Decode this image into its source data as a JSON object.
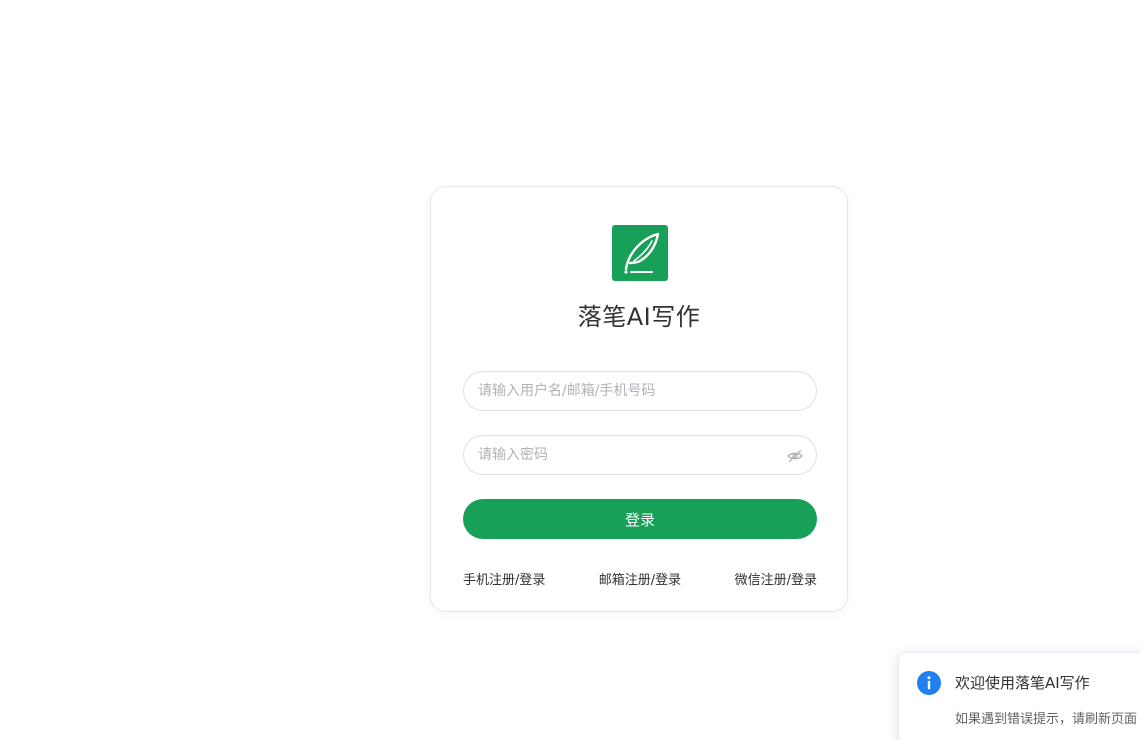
{
  "app": {
    "title": "落笔AI写作",
    "logo_icon": "feather-pen-icon",
    "brand_color": "#18a058"
  },
  "login_form": {
    "username_placeholder": "请输入用户名/邮箱/手机号码",
    "password_placeholder": "请输入密码",
    "password_toggle_icon": "eye-hidden-icon",
    "submit_label": "登录"
  },
  "register_links": [
    {
      "label": "手机注册/登录"
    },
    {
      "label": "邮箱注册/登录"
    },
    {
      "label": "微信注册/登录"
    }
  ],
  "notification": {
    "icon": "info-icon",
    "icon_color": "#2080f0",
    "title": "欢迎使用落笔AI写作",
    "message": "如果遇到错误提示，请刷新页面"
  }
}
